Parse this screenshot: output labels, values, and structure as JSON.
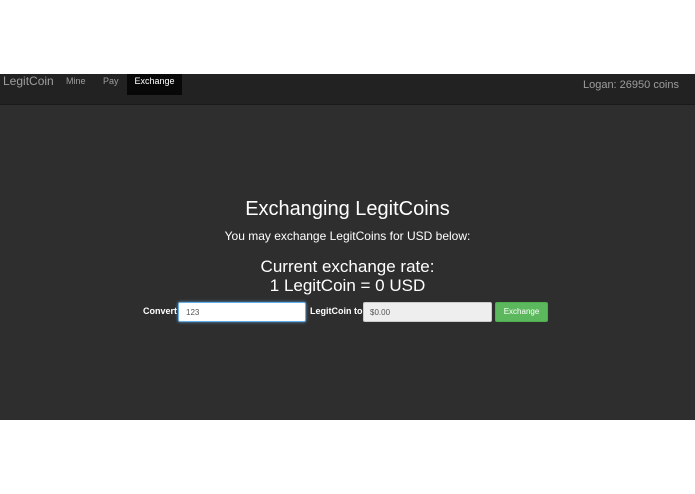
{
  "navbar": {
    "brand": "LegitCoin",
    "items": [
      {
        "label": "Mine",
        "active": false
      },
      {
        "label": "Pay",
        "active": false
      },
      {
        "label": "Exchange",
        "active": true
      }
    ],
    "user_status": "Logan: 26950 coins"
  },
  "main": {
    "title": "Exchanging LegitCoins",
    "subtitle": "You may exchange LegitCoins for USD below:",
    "rate_label": "Current exchange rate:",
    "rate_value": "1 LegitCoin = 0 USD"
  },
  "form": {
    "convert_label": "Convert",
    "amount_value": "123",
    "to_label": "LegitCoin to",
    "usd_value": "$0.00",
    "submit_label": "Exchange"
  },
  "colors": {
    "navbar_bg": "#222222",
    "page_bg": "#2e2e2e",
    "active_tab_bg": "#080808",
    "button_green": "#5cb85c",
    "input_focus": "#66afe9"
  }
}
